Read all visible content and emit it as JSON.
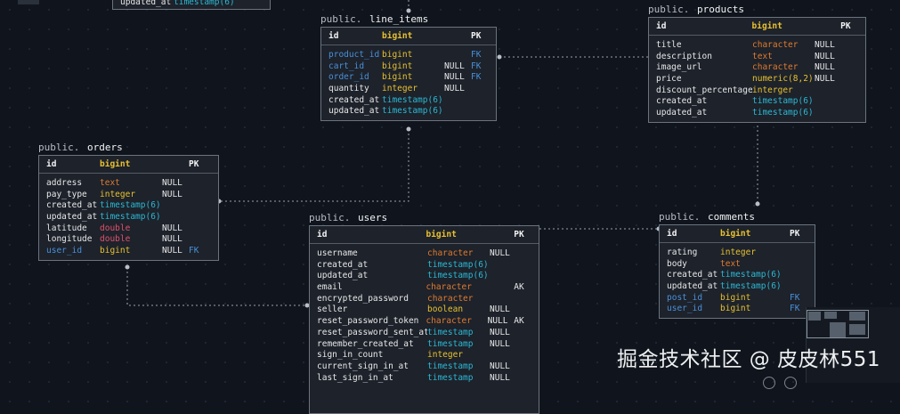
{
  "tables": {
    "top_partial": {
      "rows": [
        {
          "name": "updated_at",
          "type": "timestamp(6)",
          "null": "",
          "key": ""
        }
      ]
    },
    "line_items": {
      "schema": "public.",
      "name": "line_items",
      "pk": {
        "name": "id",
        "type": "bigint",
        "key": "PK"
      },
      "rows": [
        {
          "name": "product_id",
          "type": "bigint",
          "null": "",
          "key": "FK",
          "fk": true
        },
        {
          "name": "cart_id",
          "type": "bigint",
          "null": "NULL",
          "key": "FK",
          "fk": true
        },
        {
          "name": "order_id",
          "type": "bigint",
          "null": "NULL",
          "key": "FK",
          "fk": true
        },
        {
          "name": "quantity",
          "type": "integer",
          "null": "NULL",
          "key": ""
        },
        {
          "name": "created_at",
          "type": "timestamp(6)",
          "null": "",
          "key": ""
        },
        {
          "name": "updated_at",
          "type": "timestamp(6)",
          "null": "",
          "key": ""
        }
      ]
    },
    "products": {
      "schema": "public.",
      "name": "products",
      "pk": {
        "name": "id",
        "type": "bigint",
        "key": "PK"
      },
      "rows": [
        {
          "name": "title",
          "type": "character",
          "null": "NULL",
          "key": ""
        },
        {
          "name": "description",
          "type": "text",
          "null": "NULL",
          "key": ""
        },
        {
          "name": "image_url",
          "type": "character",
          "null": "NULL",
          "key": ""
        },
        {
          "name": "price",
          "type": "numeric(8,2)",
          "null": "NULL",
          "key": ""
        },
        {
          "name": "discount_percentage",
          "type": "interger",
          "null": "",
          "key": ""
        },
        {
          "name": "created_at",
          "type": "timestamp(6)",
          "null": "",
          "key": ""
        },
        {
          "name": "updated_at",
          "type": "timestamp(6)",
          "null": "",
          "key": ""
        }
      ]
    },
    "orders": {
      "schema": "public.",
      "name": "orders",
      "pk": {
        "name": "id",
        "type": "bigint",
        "key": "PK"
      },
      "rows": [
        {
          "name": "address",
          "type": "text",
          "null": "NULL",
          "key": ""
        },
        {
          "name": "pay_type",
          "type": "integer",
          "null": "NULL",
          "key": ""
        },
        {
          "name": "created_at",
          "type": "timestamp(6)",
          "null": "",
          "key": ""
        },
        {
          "name": "updated_at",
          "type": "timestamp(6)",
          "null": "",
          "key": ""
        },
        {
          "name": "latitude",
          "type": "double",
          "null": "NULL",
          "key": ""
        },
        {
          "name": "longitude",
          "type": "double",
          "null": "NULL",
          "key": ""
        },
        {
          "name": "user_id",
          "type": "bigint",
          "null": "NULL",
          "key": "FK",
          "fk": true
        }
      ]
    },
    "users": {
      "schema": "public.",
      "name": "users",
      "pk": {
        "name": "id",
        "type": "bigint",
        "key": "PK"
      },
      "rows": [
        {
          "name": "username",
          "type": "character",
          "null": "NULL",
          "key": ""
        },
        {
          "name": "created_at",
          "type": "timestamp(6)",
          "null": "",
          "key": ""
        },
        {
          "name": "updated_at",
          "type": "timestamp(6)",
          "null": "",
          "key": ""
        },
        {
          "name": "email",
          "type": "character",
          "null": "",
          "key": "AK"
        },
        {
          "name": "encrypted_password",
          "type": "character",
          "null": "",
          "key": ""
        },
        {
          "name": "seller",
          "type": "boolean",
          "null": "NULL",
          "key": ""
        },
        {
          "name": "reset_password_token",
          "type": "character",
          "null": "NULL",
          "key": "AK"
        },
        {
          "name": "reset_password_sent_at",
          "type": "timestamp",
          "null": "NULL",
          "key": ""
        },
        {
          "name": "remember_created_at",
          "type": "timestamp",
          "null": "NULL",
          "key": ""
        },
        {
          "name": "sign_in_count",
          "type": "integer",
          "null": "",
          "key": ""
        },
        {
          "name": "current_sign_in_at",
          "type": "timestamp",
          "null": "NULL",
          "key": ""
        },
        {
          "name": "last_sign_in_at",
          "type": "timestamp",
          "null": "NULL",
          "key": ""
        }
      ]
    },
    "comments": {
      "schema": "public.",
      "name": "comments",
      "pk": {
        "name": "id",
        "type": "bigint",
        "key": "PK"
      },
      "rows": [
        {
          "name": "rating",
          "type": "integer",
          "null": "",
          "key": ""
        },
        {
          "name": "body",
          "type": "text",
          "null": "",
          "key": ""
        },
        {
          "name": "created_at",
          "type": "timestamp(6)",
          "null": "",
          "key": ""
        },
        {
          "name": "updated_at",
          "type": "timestamp(6)",
          "null": "",
          "key": ""
        },
        {
          "name": "post_id",
          "type": "bigint",
          "null": "",
          "key": "FK",
          "fk": true
        },
        {
          "name": "user_id",
          "type": "bigint",
          "null": "",
          "key": "FK",
          "fk": true
        }
      ]
    }
  },
  "watermark": "掘金技术社区 @ 皮皮林551",
  "colors": {
    "background": "#10151d",
    "table_bg": "#1d222b",
    "border": "#6c737d",
    "fk": "#4a90d9",
    "timestamp": "#2cb8d3",
    "character": "#e07b2e",
    "bigint": "#e8c12e",
    "double": "#e0526b"
  },
  "icons": {
    "minimap": "minimap-icon",
    "zoom": "zoom-control-icon"
  }
}
